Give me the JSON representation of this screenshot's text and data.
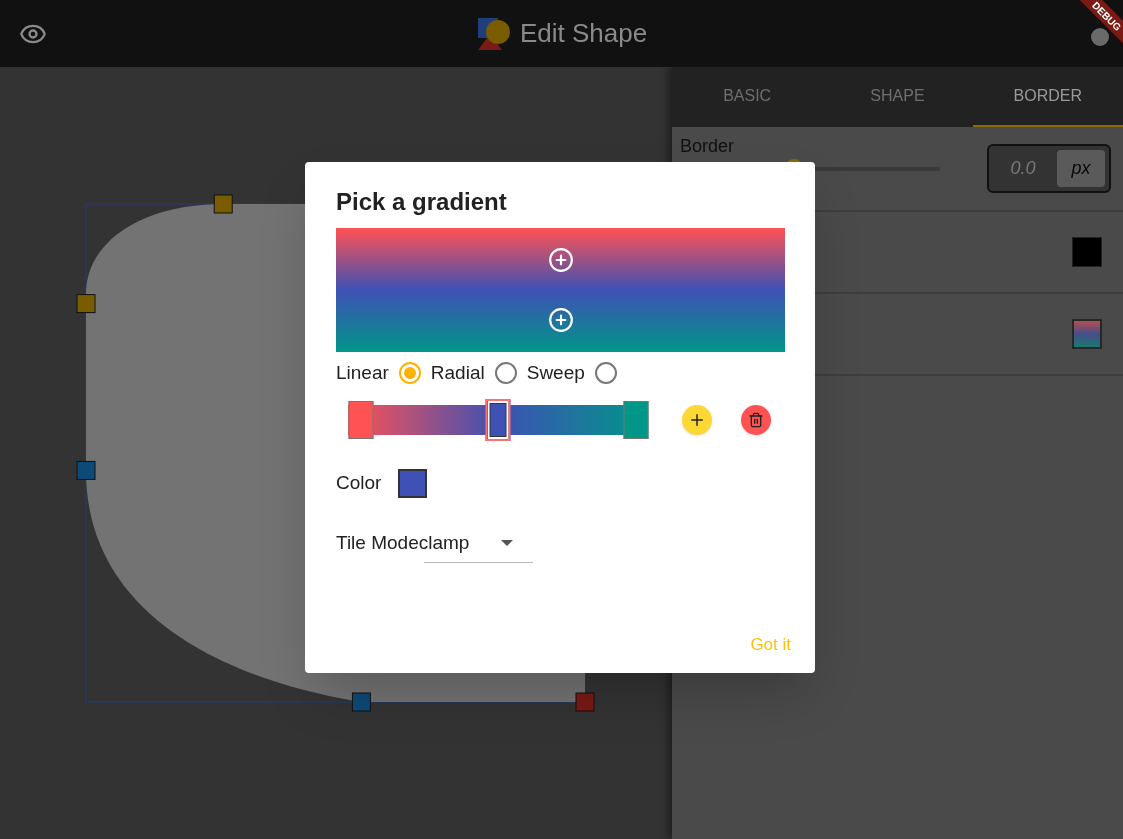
{
  "app_bar": {
    "title": "Edit Shape",
    "debug_banner": "DEBUG"
  },
  "canvas": {
    "handles": [
      {
        "color": "#7a5c00"
      },
      {
        "color": "#7a5c00"
      },
      {
        "color": "#0d4a78"
      },
      {
        "color": "#0d4a78"
      },
      {
        "color": "#7a1a14"
      }
    ]
  },
  "tabs": [
    {
      "label": "BASIC",
      "selected": false
    },
    {
      "label": "SHAPE",
      "selected": false
    },
    {
      "label": "BORDER",
      "selected": true
    }
  ],
  "border_panel": {
    "label": "Border",
    "slider": {
      "level": 0
    },
    "value": "0.0",
    "unit": "px",
    "swatches": [
      {
        "kind": "solid",
        "color": "#000000"
      },
      {
        "kind": "gradient"
      }
    ]
  },
  "dialog": {
    "title": "Pick a gradient",
    "types": [
      {
        "label": "Linear",
        "selected": true
      },
      {
        "label": "Radial",
        "selected": false
      },
      {
        "label": "Sweep",
        "selected": false
      }
    ],
    "stops": [
      {
        "color": "#ff5252",
        "level": 0,
        "selected": false
      },
      {
        "color": "#3f51b5",
        "level": 0.5,
        "selected": true
      },
      {
        "color": "#009688",
        "level": 1,
        "selected": false
      }
    ],
    "color_label": "Color",
    "color": "#3f51b5",
    "tile_mode": "Tile Modeclamp",
    "button": "Got it"
  }
}
